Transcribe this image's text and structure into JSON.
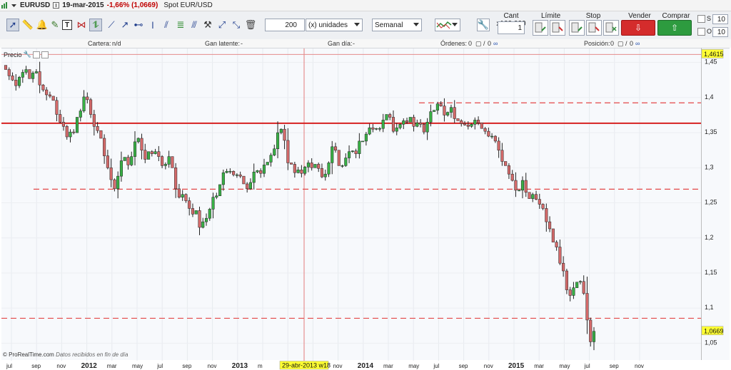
{
  "titlebar": {
    "symbol": "EURUSD",
    "date": "19-mar-2015",
    "change": "-1,66% (1,0669)",
    "instrument": "Spot EUR/USD"
  },
  "toolbar": {
    "tools": [
      "pointer-tool",
      "ruler-tool",
      "alert-bell-tool",
      "text-tool",
      "trendline-red-tool",
      "trendline-green-tool",
      "line-tool",
      "ray-tool",
      "horizontal-line-tool",
      "vertical-line-tool",
      "channel-tool",
      "fibonacci-tool",
      "fibonacci-fan-tool",
      "hammer-tool",
      "arrow-up-tool",
      "arrow-down-tool",
      "trash-tool"
    ],
    "unit_count": "200",
    "unit_type": "(x) unidades",
    "period": "Semanal",
    "order_qty_label": "Cant x100.000",
    "order_qty_value": "1",
    "limit_label": "Límite",
    "stop_label": "Stop",
    "sell_mkt_label": "Vender MKT",
    "buy_mkt_label": "Comprar MKT",
    "s_label": "S",
    "s_value": "10",
    "o_label": "O",
    "o_value": "10"
  },
  "status": {
    "cartera_label": "Cartera:",
    "cartera_value": "n/d",
    "gan_latente_label": "Gan latente:",
    "gan_latente_value": "-",
    "gan_dia_label": "Gan día:",
    "gan_dia_value": "-",
    "ordenes_label": "Órdenes:",
    "ordenes_value": "0",
    "ordenes_sep": "/",
    "ordenes_value2": "0",
    "posicion_label": "Posición:",
    "posicion_value": "0",
    "posicion_sep": "/",
    "posicion_value2": "0"
  },
  "panel_label": "Precio",
  "watermark": {
    "brand": "© ProRealTime.com",
    "note": "Datos recibidos en fin de día"
  },
  "crosshair_label": "29-abr-2013 w18",
  "colors": {
    "bull": "#38b045",
    "bear": "#d46a6a",
    "support_line": "#e34848",
    "major_line": "#d62222",
    "price_tag_bg": "#ffff33"
  },
  "chart_data": {
    "type": "candlestick",
    "title": "",
    "xlabel": "",
    "ylabel": "",
    "timeframe": "weekly",
    "ylim": [
      1.025,
      1.47
    ],
    "y_ticks": [
      "1,05",
      "1,1",
      "1,15",
      "1,2",
      "1,25",
      "1,3",
      "1,35",
      "1,4",
      "1,45"
    ],
    "y_tick_values": [
      1.05,
      1.1,
      1.15,
      1.2,
      1.25,
      1.3,
      1.35,
      1.4,
      1.45
    ],
    "x_ticks": [
      "jul",
      "sep",
      "nov",
      "2012",
      "mar",
      "may",
      "jul",
      "sep",
      "nov",
      "2013",
      "m",
      "jul",
      "sep",
      "nov",
      "2014",
      "mar",
      "may",
      "jul",
      "sep",
      "nov",
      "2015",
      "mar",
      "may",
      "jul",
      "sep",
      "nov"
    ],
    "bold_ticks": [
      "2012",
      "2013",
      "2014",
      "2015"
    ],
    "last_price_label": "1,0669",
    "last_price": 1.0669,
    "top_price_label": "1,4615",
    "top_price": 1.4615,
    "horizontal_lines": [
      {
        "price": 1.4615,
        "style": "thin-solid"
      },
      {
        "price": 1.3925,
        "style": "dashed"
      },
      {
        "price": 1.3635,
        "style": "thick-solid"
      },
      {
        "price": 1.2695,
        "style": "dashed"
      },
      {
        "price": 1.0855,
        "style": "dashed"
      }
    ],
    "closes": [
      1.44,
      1.431,
      1.425,
      1.417,
      1.429,
      1.436,
      1.44,
      1.427,
      1.435,
      1.437,
      1.418,
      1.411,
      1.404,
      1.402,
      1.396,
      1.376,
      1.365,
      1.359,
      1.344,
      1.351,
      1.35,
      1.372,
      1.381,
      1.401,
      1.397,
      1.376,
      1.359,
      1.353,
      1.342,
      1.317,
      1.3,
      1.283,
      1.27,
      1.288,
      1.31,
      1.315,
      1.304,
      1.316,
      1.337,
      1.342,
      1.325,
      1.312,
      1.323,
      1.32,
      1.323,
      1.316,
      1.303,
      1.305,
      1.316,
      1.3,
      1.27,
      1.258,
      1.262,
      1.253,
      1.242,
      1.234,
      1.239,
      1.215,
      1.223,
      1.228,
      1.241,
      1.258,
      1.26,
      1.276,
      1.293,
      1.295,
      1.295,
      1.29,
      1.29,
      1.288,
      1.277,
      1.27,
      1.279,
      1.294,
      1.296,
      1.292,
      1.304,
      1.308,
      1.318,
      1.327,
      1.35,
      1.355,
      1.339,
      1.307,
      1.305,
      1.293,
      1.297,
      1.292,
      1.301,
      1.307,
      1.3,
      1.305,
      1.299,
      1.287,
      1.291,
      1.307,
      1.33,
      1.325,
      1.303,
      1.303,
      1.314,
      1.323,
      1.324,
      1.32,
      1.338,
      1.338,
      1.348,
      1.357,
      1.355,
      1.356,
      1.356,
      1.368,
      1.376,
      1.372,
      1.352,
      1.357,
      1.362,
      1.367,
      1.365,
      1.372,
      1.359,
      1.364,
      1.362,
      1.351,
      1.365,
      1.38,
      1.382,
      1.391,
      1.388,
      1.375,
      1.379,
      1.386,
      1.37,
      1.367,
      1.363,
      1.361,
      1.359,
      1.362,
      1.368,
      1.364,
      1.356,
      1.352,
      1.345,
      1.345,
      1.338,
      1.325,
      1.309,
      1.303,
      1.291,
      1.282,
      1.268,
      1.268,
      1.282,
      1.265,
      1.256,
      1.262,
      1.255,
      1.248,
      1.242,
      1.223,
      1.213,
      1.194,
      1.187,
      1.164,
      1.153,
      1.126,
      1.118,
      1.129,
      1.137,
      1.138,
      1.121,
      1.083,
      1.052,
      1.0669
    ]
  }
}
